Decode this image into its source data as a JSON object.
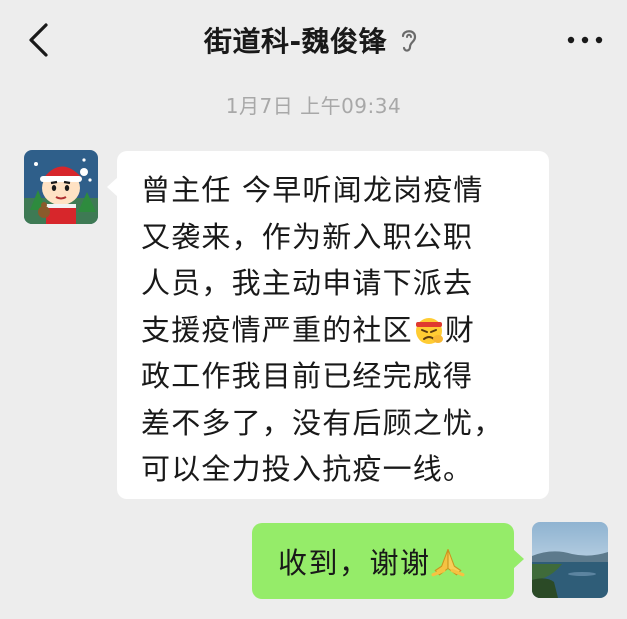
{
  "header": {
    "title": "街道科-魏俊锋",
    "back_icon": "chevron-left-icon",
    "mute_icon": "ear-muted-icon",
    "more_icon": "more-dots-icon"
  },
  "timestamp": "1月7日 上午09:34",
  "incoming_message": {
    "lines_before_emoji": [
      "曾主任 今早听闻龙岗疫情",
      "又袭来，作为新入职公职",
      "人员，我主动申请下派去"
    ],
    "line4_before_emoji": "支援疫情严重的社区",
    "line4_emoji": "determined-face-emoji",
    "line4_after_emoji": "财",
    "lines_after_emoji": [
      "政工作我目前已经完成得",
      "差不多了，没有后顾之忧，",
      "可以全力投入抗疫一线。"
    ]
  },
  "outgoing_message": {
    "text": "收到，谢谢",
    "emoji": "praying-hands-emoji"
  },
  "colors": {
    "background": "#ededed",
    "incoming_bubble": "#ffffff",
    "outgoing_bubble": "#95ec69",
    "timestamp": "#a8a8a8",
    "text": "#191919"
  }
}
